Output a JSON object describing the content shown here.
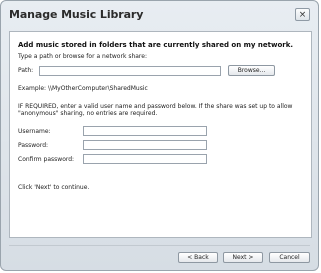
{
  "window": {
    "title": "Manage Music Library",
    "close_label": "×"
  },
  "content": {
    "heading": "Add music stored in folders that are currently shared on my network.",
    "path_hint": "Type a path or browse for a network share:",
    "path_label": "Path:",
    "path_value": "",
    "browse_label": "Browse...",
    "example": "Example: \\\\MyOtherComputer\\SharedMusic",
    "required_line1": "IF REQUIRED, enter a valid user name and password below.  If the share was set up to allow",
    "required_line2": "\"anonymous\" sharing, no entries are required.",
    "username_label": "Username:",
    "password_label": "Password:",
    "confirm_label": "Confirm password:",
    "username_value": "",
    "password_value": "",
    "confirm_value": "",
    "continue_text": "Click 'Next' to continue."
  },
  "buttons": {
    "back": "< Back",
    "next": "Next >",
    "cancel": "Cancel"
  }
}
